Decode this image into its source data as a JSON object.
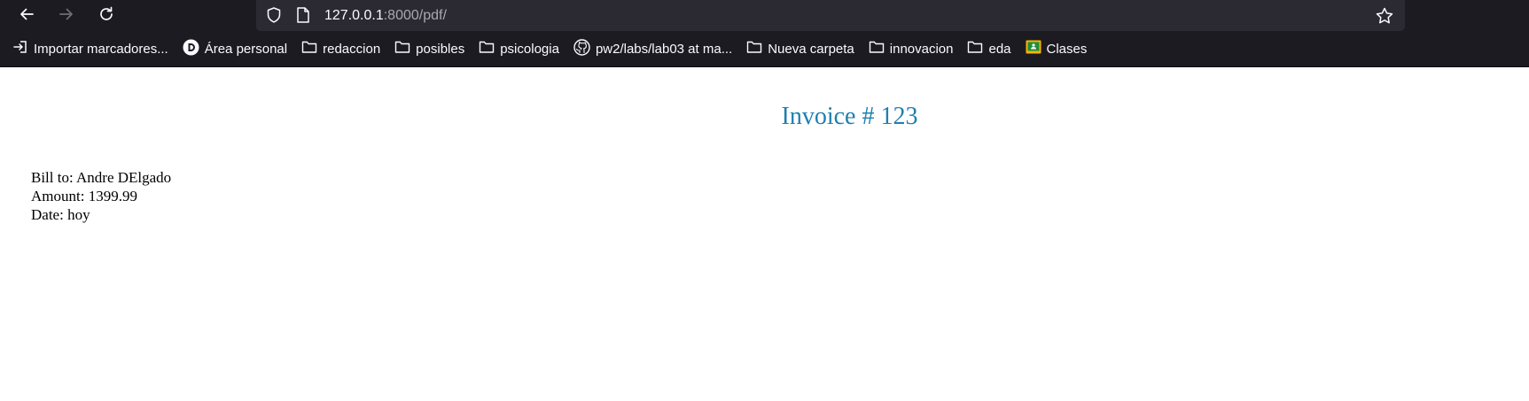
{
  "browser": {
    "url_host": "127.0.0.1",
    "url_rest": ":8000/pdf/",
    "nav": {
      "back": "back-arrow-icon",
      "forward": "forward-arrow-icon",
      "reload": "reload-icon"
    }
  },
  "bookmarks": [
    {
      "label": "Importar marcadores...",
      "icon": "import-icon"
    },
    {
      "label": "Área personal",
      "icon": "d-logo-icon"
    },
    {
      "label": "redaccion",
      "icon": "folder-icon"
    },
    {
      "label": "posibles",
      "icon": "folder-icon"
    },
    {
      "label": "psicologia",
      "icon": "folder-icon"
    },
    {
      "label": "pw2/labs/lab03 at ma...",
      "icon": "github-icon"
    },
    {
      "label": "Nueva carpeta",
      "icon": "folder-icon"
    },
    {
      "label": "innovacion",
      "icon": "folder-icon"
    },
    {
      "label": "eda",
      "icon": "folder-icon"
    },
    {
      "label": "Clases",
      "icon": "classroom-icon"
    }
  ],
  "invoice": {
    "title": "Invoice # 123",
    "bill_to": "Bill to: Andre DElgado",
    "amount": "Amount: 1399.99",
    "date": "Date: hoy"
  },
  "colors": {
    "chrome_bg": "#1c1b22",
    "urlbar_bg": "#2b2a33",
    "title": "#1f7fb0"
  }
}
